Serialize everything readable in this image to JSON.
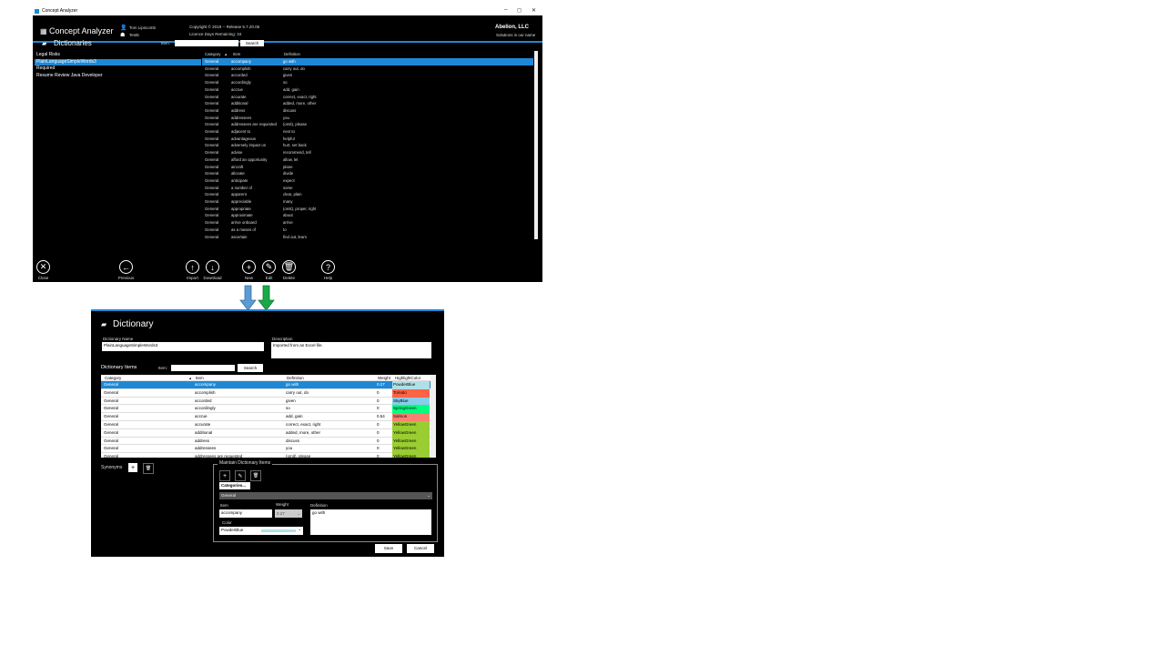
{
  "main_window": {
    "title": "Concept Analyzer",
    "controls": [
      "–",
      "◻",
      "✕"
    ],
    "header": {
      "app_name": "Concept Analyzer",
      "user_name": "Tom Lipscomb",
      "project": "Test5",
      "copyright": "Copyright © 2018 -- Release 5.7.20.06",
      "license": "Licence Days Remaining: 34",
      "company": "Abelion, LLC",
      "tagline": "Solutions is our name"
    },
    "page_title": "Dictionaries",
    "search_label": "Item:",
    "search_value": "",
    "search_button": "Search",
    "dictionaries": [
      "Legal Risks",
      "PlainLanguageSimpleWords3",
      "Required",
      "Resume Review Java Developer"
    ],
    "selected_dictionary_index": 1,
    "table_headers": {
      "category": "Category",
      "item": "Item",
      "definition": "Definition"
    },
    "rows": [
      {
        "category": "General",
        "item": "accompany",
        "definition": "go with"
      },
      {
        "category": "General",
        "item": "accomplish",
        "definition": "carry out, do"
      },
      {
        "category": "General",
        "item": "accorded",
        "definition": "given"
      },
      {
        "category": "General",
        "item": "accordingly",
        "definition": "so"
      },
      {
        "category": "General",
        "item": "accrue",
        "definition": "add, gain"
      },
      {
        "category": "General",
        "item": "accurate",
        "definition": "correct, exact, right"
      },
      {
        "category": "General",
        "item": "additional",
        "definition": "added, more, other"
      },
      {
        "category": "General",
        "item": "address",
        "definition": "discuss"
      },
      {
        "category": "General",
        "item": "addressees",
        "definition": "you"
      },
      {
        "category": "General",
        "item": "addressees are requested",
        "definition": "(omit), please"
      },
      {
        "category": "General",
        "item": "adjacent to",
        "definition": "next to"
      },
      {
        "category": "General",
        "item": "advantageous",
        "definition": "helpful"
      },
      {
        "category": "General",
        "item": "adversely impact on",
        "definition": "hurt, set back"
      },
      {
        "category": "General",
        "item": "advise",
        "definition": "recommend, tell"
      },
      {
        "category": "General",
        "item": "afford an opportunity",
        "definition": "allow, let"
      },
      {
        "category": "General",
        "item": "aircraft",
        "definition": "plane"
      },
      {
        "category": "General",
        "item": "allocate",
        "definition": "divide"
      },
      {
        "category": "General",
        "item": "anticipate",
        "definition": "expect"
      },
      {
        "category": "General",
        "item": "a number of",
        "definition": "some"
      },
      {
        "category": "General",
        "item": "apparent",
        "definition": "clear, plain"
      },
      {
        "category": "General",
        "item": "appreciable",
        "definition": "many"
      },
      {
        "category": "General",
        "item": "appropriate",
        "definition": "(omit), proper, right"
      },
      {
        "category": "General",
        "item": "approximate",
        "definition": "about"
      },
      {
        "category": "General",
        "item": "arrive onboard",
        "definition": "arrive"
      },
      {
        "category": "General",
        "item": "as a means of",
        "definition": "to"
      },
      {
        "category": "General",
        "item": "ascertain",
        "definition": "find out, learn"
      }
    ],
    "toolbar": [
      {
        "label": "Close",
        "icon": "close-icon",
        "glyph": "✕"
      },
      {
        "label": "Previous",
        "icon": "previous-icon",
        "glyph": "←"
      },
      {
        "label": "Import",
        "icon": "import-icon",
        "glyph": "↑"
      },
      {
        "label": "Download",
        "icon": "download-icon",
        "glyph": "↓"
      },
      {
        "label": "New",
        "icon": "new-icon",
        "glyph": "+"
      },
      {
        "label": "Edit",
        "icon": "edit-icon",
        "glyph": "✎"
      },
      {
        "label": "Delete",
        "icon": "delete-icon",
        "glyph": "🗑"
      },
      {
        "label": "Help",
        "icon": "help-icon",
        "glyph": "?"
      }
    ]
  },
  "dialog": {
    "title": "Dictionary",
    "name_label": "Dictionary Name",
    "name_value": "PlainLanguageSimpleWords3",
    "description_label": "Description",
    "description_value": "Imported from an Excel file.",
    "items_label": "Dictionary Items",
    "search_label": "Item:",
    "search_button": "Search",
    "table_headers": {
      "category": "Category",
      "item": "Item",
      "definition": "Definition",
      "weight": "Weight",
      "color": "HighlightColor"
    },
    "rows": [
      {
        "category": "General",
        "item": "accompany",
        "definition": "go with",
        "weight": "0.27",
        "color": "PowderBlue",
        "hex": "#b0e0e6"
      },
      {
        "category": "General",
        "item": "accomplish",
        "definition": "carry out, do",
        "weight": "0",
        "color": "Tomato",
        "hex": "#ff6347"
      },
      {
        "category": "General",
        "item": "accorded",
        "definition": "given",
        "weight": "0",
        "color": "SkyBlue",
        "hex": "#87ceeb"
      },
      {
        "category": "General",
        "item": "accordingly",
        "definition": "so",
        "weight": "0",
        "color": "SpringGreen",
        "hex": "#00ff7f"
      },
      {
        "category": "General",
        "item": "accrue",
        "definition": "add, gain",
        "weight": "0.54",
        "color": "Salmon",
        "hex": "#fa8072"
      },
      {
        "category": "General",
        "item": "accurate",
        "definition": "correct, exact, right",
        "weight": "0",
        "color": "YellowGreen",
        "hex": "#9acd32"
      },
      {
        "category": "General",
        "item": "additional",
        "definition": "added, more, other",
        "weight": "0",
        "color": "YellowGreen",
        "hex": "#9acd32"
      },
      {
        "category": "General",
        "item": "address",
        "definition": "discuss",
        "weight": "0",
        "color": "YellowGreen",
        "hex": "#9acd32"
      },
      {
        "category": "General",
        "item": "addressees",
        "definition": "you",
        "weight": "0",
        "color": "YellowGreen",
        "hex": "#9acd32"
      },
      {
        "category": "General",
        "item": "addressees are requested",
        "definition": "(omit), please",
        "weight": "0",
        "color": "YellowGreen",
        "hex": "#9acd32"
      }
    ],
    "synonyms_label": "Synonyms",
    "maintain_label": "Maintain Dictionary Items",
    "categories_button": "Categories...",
    "category_value": "General",
    "item_label": "Item",
    "item_value": "accompany",
    "weight_label": "Weight",
    "weight_value": "0.27",
    "definition_label": "Definition",
    "definition_value": "go with",
    "color_label": "Color",
    "color_value": "PowderBlue",
    "color_hex": "#b0e0e6",
    "save_button": "Save",
    "cancel_button": "Cancel"
  },
  "arrows": {
    "blue": "#5b9bd5",
    "green": "#1aa84a"
  }
}
